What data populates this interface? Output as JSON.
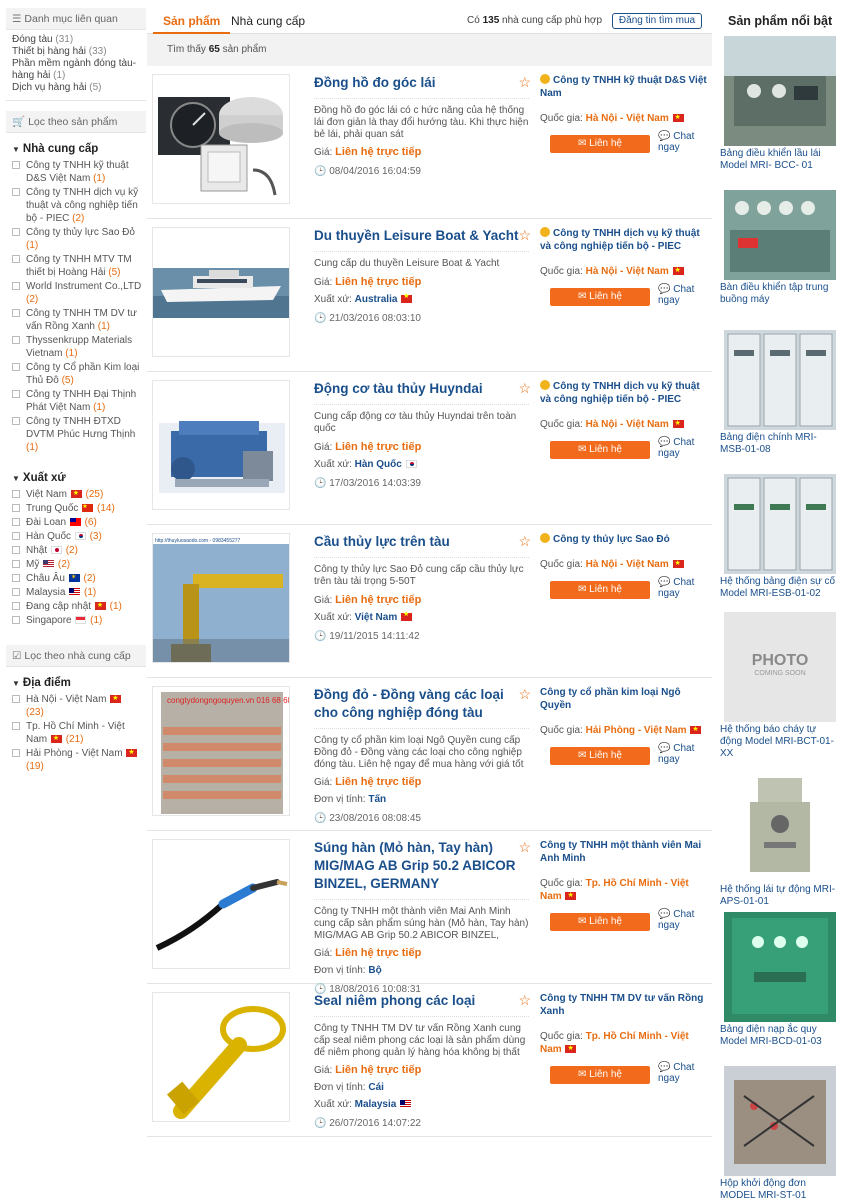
{
  "sidebar": {
    "related_header": "Danh mục liên quan",
    "categories": [
      {
        "label": "Đóng tàu",
        "count": "(31)"
      },
      {
        "label": "Thiết bị hàng hải",
        "count": "(33)"
      },
      {
        "label": "Phần mềm ngành đóng tàu-hàng hải",
        "count": "(1)"
      },
      {
        "label": "Dịch vụ hàng hải",
        "count": "(5)"
      }
    ],
    "filter_products_header": "Lọc theo sản phẩm",
    "suppliers_title": "Nhà cung cấp",
    "suppliers": [
      {
        "label": "Công ty TNHH kỹ thuật D&S Việt Nam",
        "count": "(1)"
      },
      {
        "label": "Công ty TNHH dịch vụ kỹ thuật và công nghiệp tiến bộ - PIEC",
        "count": "(2)"
      },
      {
        "label": "Công ty thủy lực Sao Đỏ",
        "count": "(1)"
      },
      {
        "label": "Công ty TNHH MTV TM thiết bị Hoàng Hải",
        "count": "(5)"
      },
      {
        "label": "World Instrument Co.,LTD",
        "count": "(2)"
      },
      {
        "label": "Công ty TNHH TM DV tư vấn Rồng Xanh",
        "count": "(1)"
      },
      {
        "label": "Thyssenkrupp Materials Vietnam",
        "count": "(1)"
      },
      {
        "label": "Công ty Cổ phần Kim loại Thủ Đô",
        "count": "(5)"
      },
      {
        "label": "Công ty TNHH Đại Thịnh Phát Việt Nam",
        "count": "(1)"
      },
      {
        "label": "Công ty TNHH ĐTXD DVTM Phúc Hưng Thịnh",
        "count": "(1)"
      }
    ],
    "origin_title": "Xuất xứ",
    "origins": [
      {
        "label": "Việt Nam",
        "flag": "vn",
        "count": "(25)"
      },
      {
        "label": "Trung Quốc",
        "flag": "cn",
        "count": "(14)"
      },
      {
        "label": "Đài Loan",
        "flag": "tw",
        "count": "(6)"
      },
      {
        "label": "Hàn Quốc",
        "flag": "kr",
        "count": "(3)"
      },
      {
        "label": "Nhật",
        "flag": "jp",
        "count": "(2)"
      },
      {
        "label": "Mỹ",
        "flag": "us",
        "count": "(2)"
      },
      {
        "label": "Châu Âu",
        "flag": "eu",
        "count": "(2)"
      },
      {
        "label": "Malaysia",
        "flag": "my",
        "count": "(1)"
      },
      {
        "label": "Đang cập nhật",
        "flag": "vn",
        "count": "(1)"
      },
      {
        "label": "Singapore",
        "flag": "sg",
        "count": "(1)"
      }
    ],
    "filter_suppliers_header": "Lọc theo nhà cung cấp",
    "location_title": "Địa điểm",
    "locations": [
      {
        "label": "Hà Nội - Việt Nam",
        "count": "(23)"
      },
      {
        "label": "Tp. Hồ Chí Minh - Việt Nam",
        "count": "(21)"
      },
      {
        "label": "Hải Phòng - Việt Nam",
        "count": "(19)"
      }
    ]
  },
  "main": {
    "tab_products": "Sản phẩm",
    "tab_suppliers": "Nhà cung cấp",
    "supplier_count_prefix": "Có",
    "supplier_count": "135",
    "supplier_count_suffix": "nhà cung cấp phù hợp",
    "post_button": "Đăng tin tìm mua",
    "found_prefix": "Tìm thấy",
    "found_count": "65",
    "found_suffix": "sản phẩm",
    "price_label": "Giá:",
    "price_value": "Liên hệ trực tiếp",
    "origin_label": "Xuất xứ:",
    "unit_label": "Đơn vị tính:",
    "country_label": "Quốc gia:",
    "contact_label": "Liên hệ",
    "chat_label": "Chat ngay",
    "products": [
      {
        "title": "Đồng hồ đo góc lái",
        "desc": "Đồng hồ đo góc lái có c hức năng của hệ thống lái đơn giản là thay đổi hướng tàu. Khi thực hiện bẻ lái, phải quan sát",
        "extra_label": "",
        "extra_value": "",
        "date": "08/04/2016 16:04:59",
        "supplier": "Công ty TNHH kỹ thuật D&S Việt Nam",
        "verified": true,
        "country": "Hà Nội - Việt Nam"
      },
      {
        "title": "Du thuyền Leisure Boat & Yacht",
        "desc": "Cung cấp du thuyền Leisure Boat & Yacht",
        "extra_label": "Xuất xứ:",
        "extra_value": "Australia",
        "date": "21/03/2016 08:03:10",
        "supplier": "Công ty TNHH dịch vụ kỹ thuật và công nghiệp tiến bộ - PIEC",
        "verified": true,
        "country": "Hà Nội - Việt Nam"
      },
      {
        "title": "Động cơ tàu thủy Huyndai",
        "desc": "Cung cấp động cơ tàu thủy Huyndai trên toàn quốc",
        "extra_label": "Xuất xứ:",
        "extra_value": "Hàn Quốc",
        "date": "17/03/2016 14:03:39",
        "supplier": "Công ty TNHH dịch vụ kỹ thuật và công nghiệp tiến bộ - PIEC",
        "verified": true,
        "country": "Hà Nội - Việt Nam"
      },
      {
        "title": "Cầu thủy lực trên tàu",
        "desc": "Công ty thủy lực Sao Đỏ cung cấp cầu thủy lực trên tàu tải trọng 5-50T",
        "extra_label": "Xuất xứ:",
        "extra_value": "Việt Nam",
        "date": "19/11/2015 14:11:42",
        "supplier": "Công ty thủy lực Sao Đỏ",
        "verified": true,
        "country": "Hà Nội - Việt Nam"
      },
      {
        "title": "Đồng đỏ - Đồng vàng các loại cho công nghiệp đóng tàu",
        "desc": "Công ty cổ phần kim loại Ngô Quyền cung cấp Đồng đỏ - Đồng vàng các loại cho công nghiệp đóng tàu. Liên hệ ngay để mua hàng với giá tốt",
        "extra_label": "Đơn vị tính:",
        "extra_value": "Tấn",
        "date": "23/08/2016 08:08:45",
        "supplier": "Công ty cổ phần kim loại Ngô Quyền",
        "verified": false,
        "country": "Hải Phòng - Việt Nam"
      },
      {
        "title": "Súng hàn (Mỏ hàn, Tay hàn) MIG/MAG AB Grip 50.2 ABICOR BINZEL, GERMANY",
        "desc": "Công ty TNHH một thành viên Mai Anh Minh cung cấp sản phẩm súng hàn (Mỏ hàn, Tay hàn) MIG/MAG AB Grip 50.2 ABICOR BINZEL,",
        "extra_label": "Đơn vị tính:",
        "extra_value": "Bộ",
        "date": "18/08/2016 10:08:31",
        "supplier": "Công ty TNHH một thành viên Mai Anh Minh",
        "verified": false,
        "country": "Tp. Hồ Chí Minh - Việt Nam"
      },
      {
        "title": "Seal niêm phong các loại",
        "desc": "Công ty TNHH TM DV tư vấn Rồng Xanh cung cấp seal niêm phong các loại là sản phẩm dùng để niêm phong quản lý hàng hóa không bị thất",
        "extra_label": "Đơn vị tính:",
        "extra_value": "Cái",
        "extra2_label": "Xuất xứ:",
        "extra2_value": "Malaysia",
        "date": "26/07/2016 14:07:22",
        "supplier": "Công ty TNHH TM DV tư vấn Rồng Xanh",
        "verified": false,
        "country": "Tp. Hồ Chí Minh - Việt Nam"
      }
    ],
    "thumb_watermark": "congtydongngoquyen.vn 016 68 68 68 38",
    "thumb_url": "http://thuyluosaodo.com - 0983455277"
  },
  "featured": {
    "title": "Sản phẩm nổi bật",
    "items": [
      {
        "caption": "Bảng điều khiển lầu lái Model MRI- BCC- 01"
      },
      {
        "caption": "Bàn điều khiển tập trung buồng máy"
      },
      {
        "caption": "Bảng điện chính MRI-MSB-01-08"
      },
      {
        "caption": "Hệ thống bảng điện sự cố Model MRI-ESB-01-02"
      },
      {
        "caption": "Hệ thống báo cháy tự động Model MRI-BCT-01-XX",
        "placeholder_big": "PHOTO",
        "placeholder_small": "COMING SOON"
      },
      {
        "caption": "Hệ thống lái tự động MRI-APS-01-01"
      },
      {
        "caption": "Bảng điện nạp ắc quy Model MRI-BCD-01-03"
      },
      {
        "caption": "Hộp khởi động đơn MODEL MRI-ST-01"
      }
    ]
  },
  "colors": {
    "accent": "#e86c10",
    "link": "#1a4f8b",
    "button": "#f26a1b"
  }
}
